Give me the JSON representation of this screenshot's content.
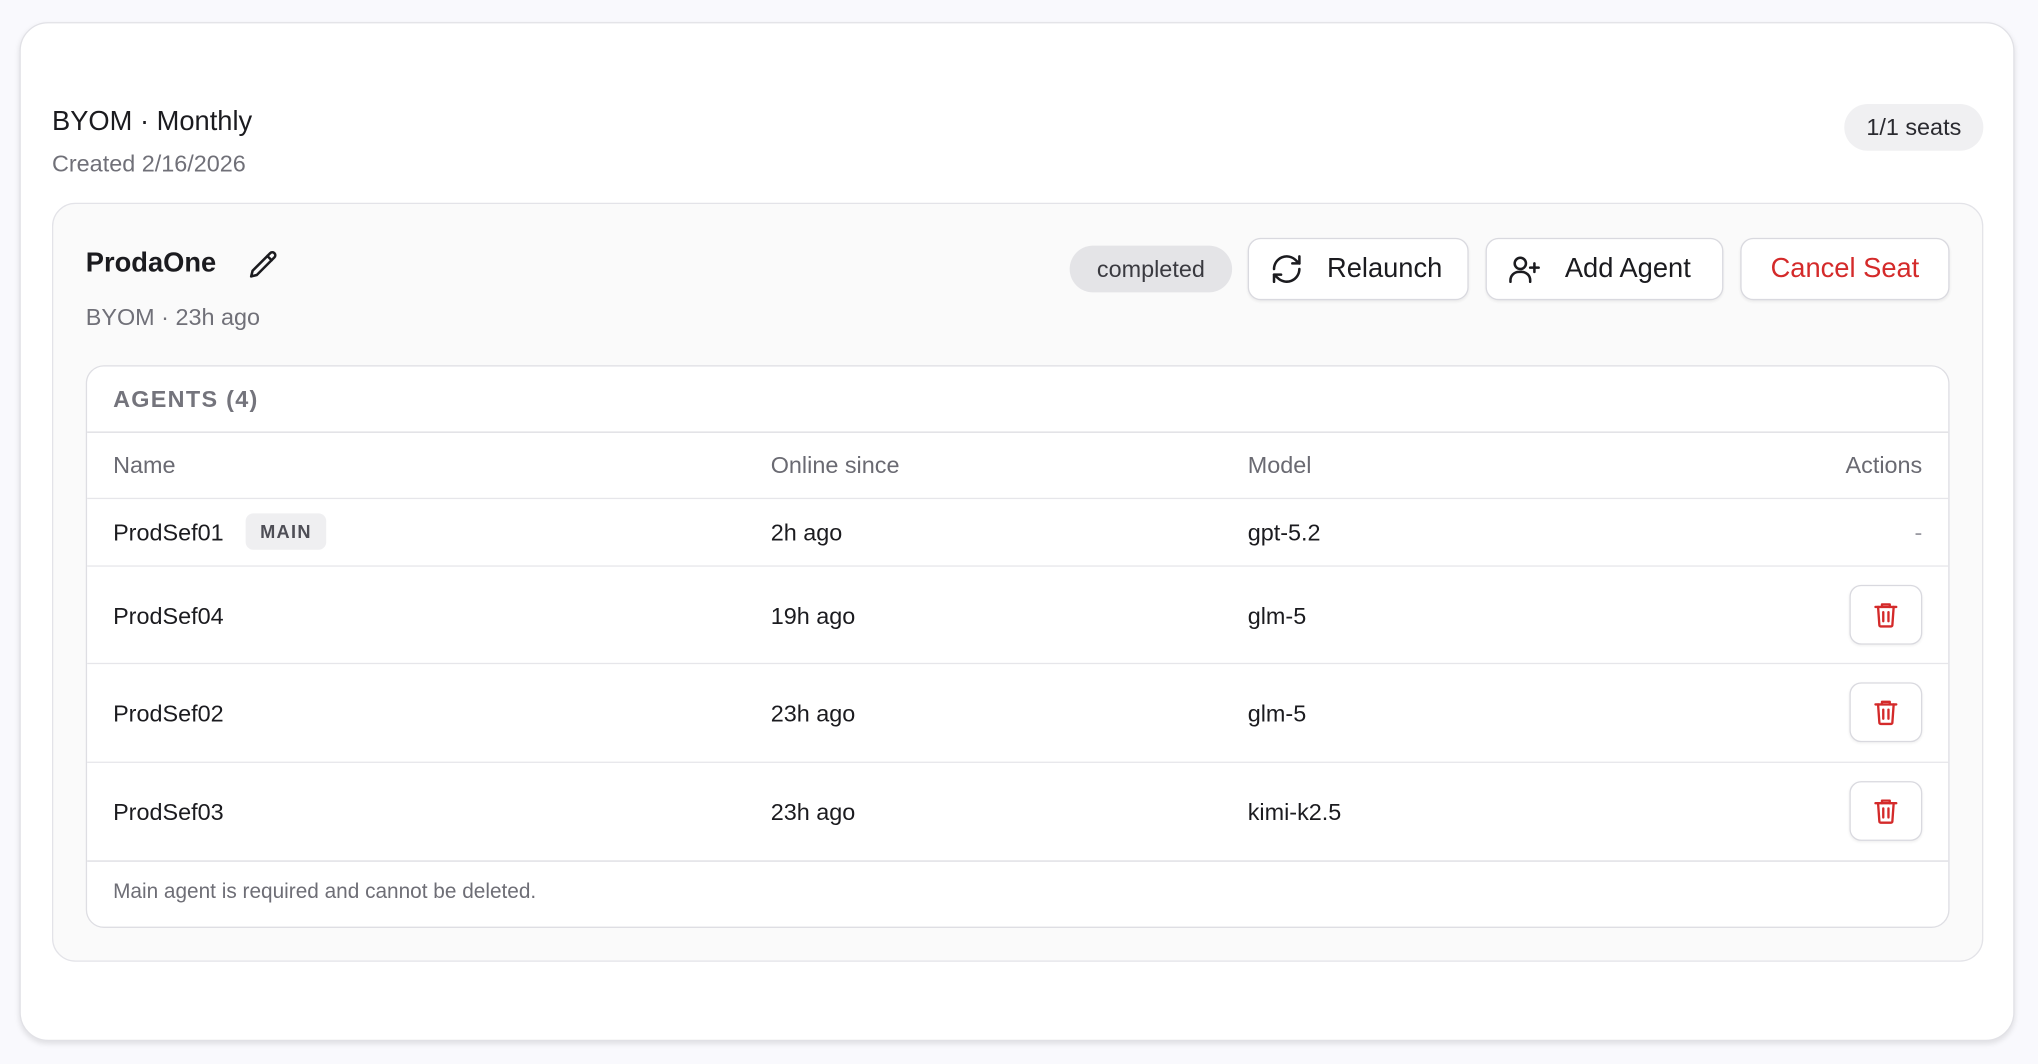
{
  "plan": {
    "title": "BYOM · Monthly",
    "created": "Created 2/16/2026",
    "seats": "1/1 seats"
  },
  "seat": {
    "name": "ProdaOne",
    "meta": "BYOM · 23h ago",
    "status": "completed",
    "actions": {
      "relaunch": "Relaunch",
      "add_agent": "Add Agent",
      "cancel_seat": "Cancel Seat"
    }
  },
  "agents": {
    "heading": "AGENTS (4)",
    "columns": {
      "name": "Name",
      "online_since": "Online since",
      "model": "Model",
      "actions": "Actions"
    },
    "rows": [
      {
        "name": "ProdSef01",
        "badge": "MAIN",
        "online_since": "2h ago",
        "model": "gpt-5.2",
        "action": "-"
      },
      {
        "name": "ProdSef04",
        "online_since": "19h ago",
        "model": "glm-5",
        "action_icon": "trash-icon"
      },
      {
        "name": "ProdSef02",
        "online_since": "23h ago",
        "model": "glm-5",
        "action_icon": "trash-icon"
      },
      {
        "name": "ProdSef03",
        "online_since": "23h ago",
        "model": "kimi-k2.5",
        "action_icon": "trash-icon"
      }
    ],
    "footnote": "Main agent is required and cannot be deleted."
  },
  "colors": {
    "danger": "#d42a2a",
    "muted_text": "#707078",
    "pill_bg": "#e4e4e7"
  },
  "icons": {
    "edit": "pencil-icon",
    "relaunch": "refresh-icon",
    "add_agent": "user-plus-icon",
    "delete": "trash-icon"
  }
}
